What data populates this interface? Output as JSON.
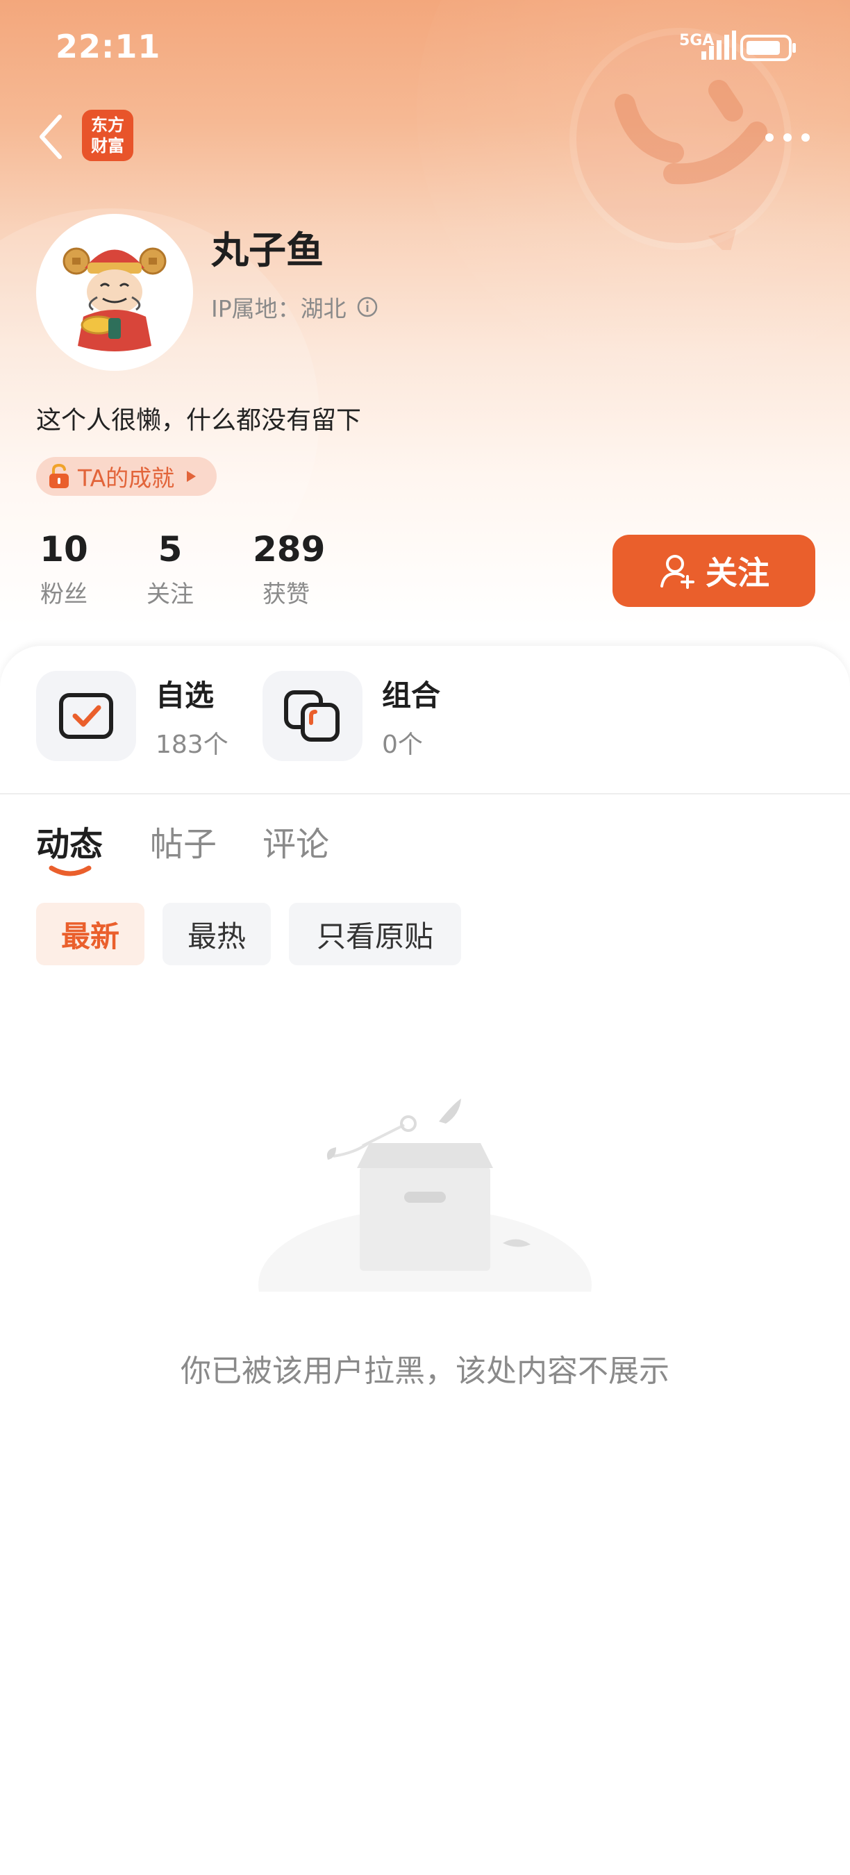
{
  "status_bar": {
    "time": "22:11",
    "network": "5GA"
  },
  "nav": {
    "app_logo_line1": "东方",
    "app_logo_line2": "财富",
    "back_icon": "chevron-left-icon",
    "more_icon": "more-dots-icon"
  },
  "profile": {
    "nickname": "丸子鱼",
    "ip_location": "IP属地：湖北",
    "bio": "这个人很懒，什么都没有留下",
    "achievement_label": "TA的成就"
  },
  "stats": [
    {
      "value": "10",
      "label": "粉丝"
    },
    {
      "value": "5",
      "label": "关注"
    },
    {
      "value": "289",
      "label": "获赞"
    }
  ],
  "follow_button": {
    "label": "关注"
  },
  "shortcuts": {
    "watchlist": {
      "title": "自选",
      "count": "183个"
    },
    "portfolio": {
      "title": "组合",
      "count": "0个"
    }
  },
  "tabs": [
    {
      "label": "动态",
      "active": true
    },
    {
      "label": "帖子",
      "active": false
    },
    {
      "label": "评论",
      "active": false
    }
  ],
  "filters": [
    {
      "label": "最新",
      "active": true
    },
    {
      "label": "最热",
      "active": false
    },
    {
      "label": "只看原贴",
      "active": false
    }
  ],
  "empty_state": {
    "message": "你已被该用户拉黑，该处内容不展示"
  },
  "colors": {
    "accent": "#ea5f2c",
    "header_gradient_top": "#f3a77c"
  }
}
